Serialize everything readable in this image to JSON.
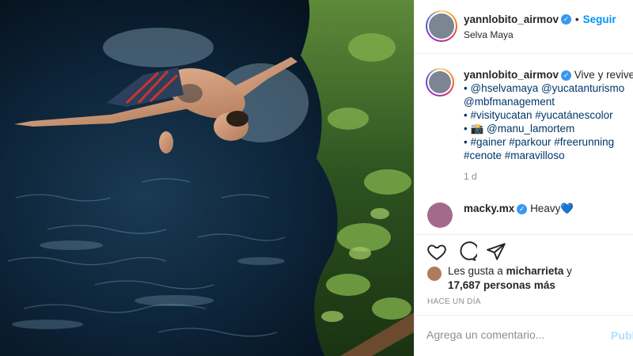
{
  "post": {
    "username": "yannlobito_airmov",
    "location": "Selva Maya",
    "follow_label": "Seguir",
    "separator": "•"
  },
  "caption": {
    "username": "yannlobito_airmov",
    "first_text": "Vive y revive",
    "lines": [
      "• @hselvamaya @yucatanturismo",
      "@mbfmanagement",
      "• #visityucatan #yucatánescolor",
      "• 📸 @manu_lamortem",
      "• #gainer #parkour #freerunning",
      "#cenote #maravilloso"
    ],
    "time": "1 d"
  },
  "comment": {
    "username": "macky.mx",
    "text": "Heavy",
    "emoji": "💙"
  },
  "icons": {
    "like": "heart-icon",
    "comment": "comment-icon",
    "share": "share-icon",
    "verified": "verified-badge-icon"
  },
  "likes": {
    "prefix": "Les gusta a",
    "liked_by": "micharrieta",
    "conjunction": "y",
    "count_text": "17,687 personas más"
  },
  "timestamp": "HACE UN DÍA",
  "comment_box": {
    "placeholder": "Agrega un comentario...",
    "post_label": "Publicar"
  },
  "colors": {
    "accent": "#0095f6",
    "verified": "#3897f0",
    "muted": "#8e8e8e"
  }
}
